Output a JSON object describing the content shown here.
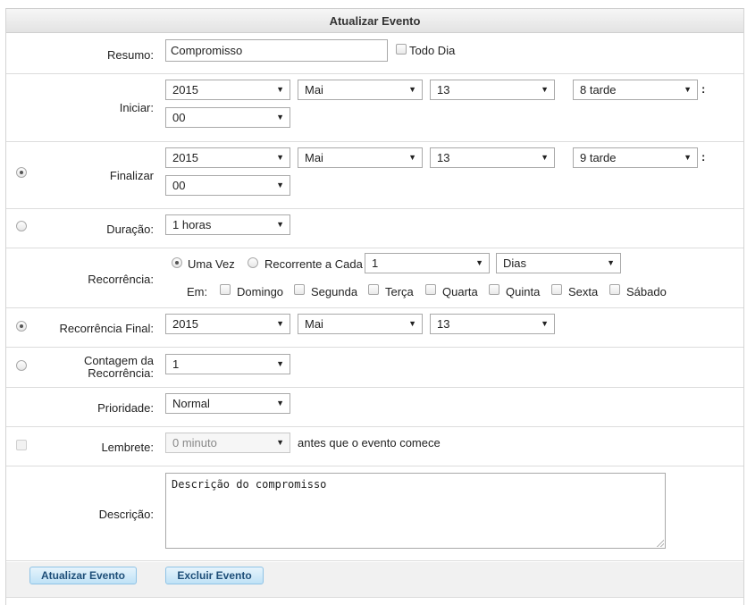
{
  "header": {
    "title": "Atualizar Evento"
  },
  "resumo": {
    "label": "Resumo:",
    "value": "Compromisso",
    "allday_label": "Todo Dia"
  },
  "iniciar": {
    "label": "Iniciar:",
    "year": "2015",
    "month": "Mai",
    "day": "13",
    "hour": "8 tarde",
    "minute": "00"
  },
  "finalizar": {
    "label": "Finalizar",
    "year": "2015",
    "month": "Mai",
    "day": "13",
    "hour": "9 tarde",
    "minute": "00"
  },
  "duracao": {
    "label": "Duração:",
    "value": "1 horas"
  },
  "recorrencia": {
    "label": "Recorrência:",
    "once_label": "Uma Vez",
    "every_label": "Recorrente a Cada",
    "interval": "1",
    "unit": "Dias",
    "on_label": "Em:",
    "days": [
      "Domingo",
      "Segunda",
      "Terça",
      "Quarta",
      "Quinta",
      "Sexta",
      "Sábado"
    ]
  },
  "recorrencia_final": {
    "label": "Recorrência Final:",
    "year": "2015",
    "month": "Mai",
    "day": "13"
  },
  "contagem": {
    "label_line1": "Contagem da",
    "label_line2": "Recorrência:",
    "value": "1"
  },
  "prioridade": {
    "label": "Prioridade:",
    "value": "Normal"
  },
  "lembrete": {
    "label": "Lembrete:",
    "value": "0 minuto",
    "suffix": "antes que o evento comece"
  },
  "descricao": {
    "label": "Descrição:",
    "value": "Descrição do compromisso"
  },
  "buttons": {
    "update": "Atualizar Evento",
    "delete": "Excluir Evento"
  },
  "colon": ":",
  "arrow": "▼"
}
